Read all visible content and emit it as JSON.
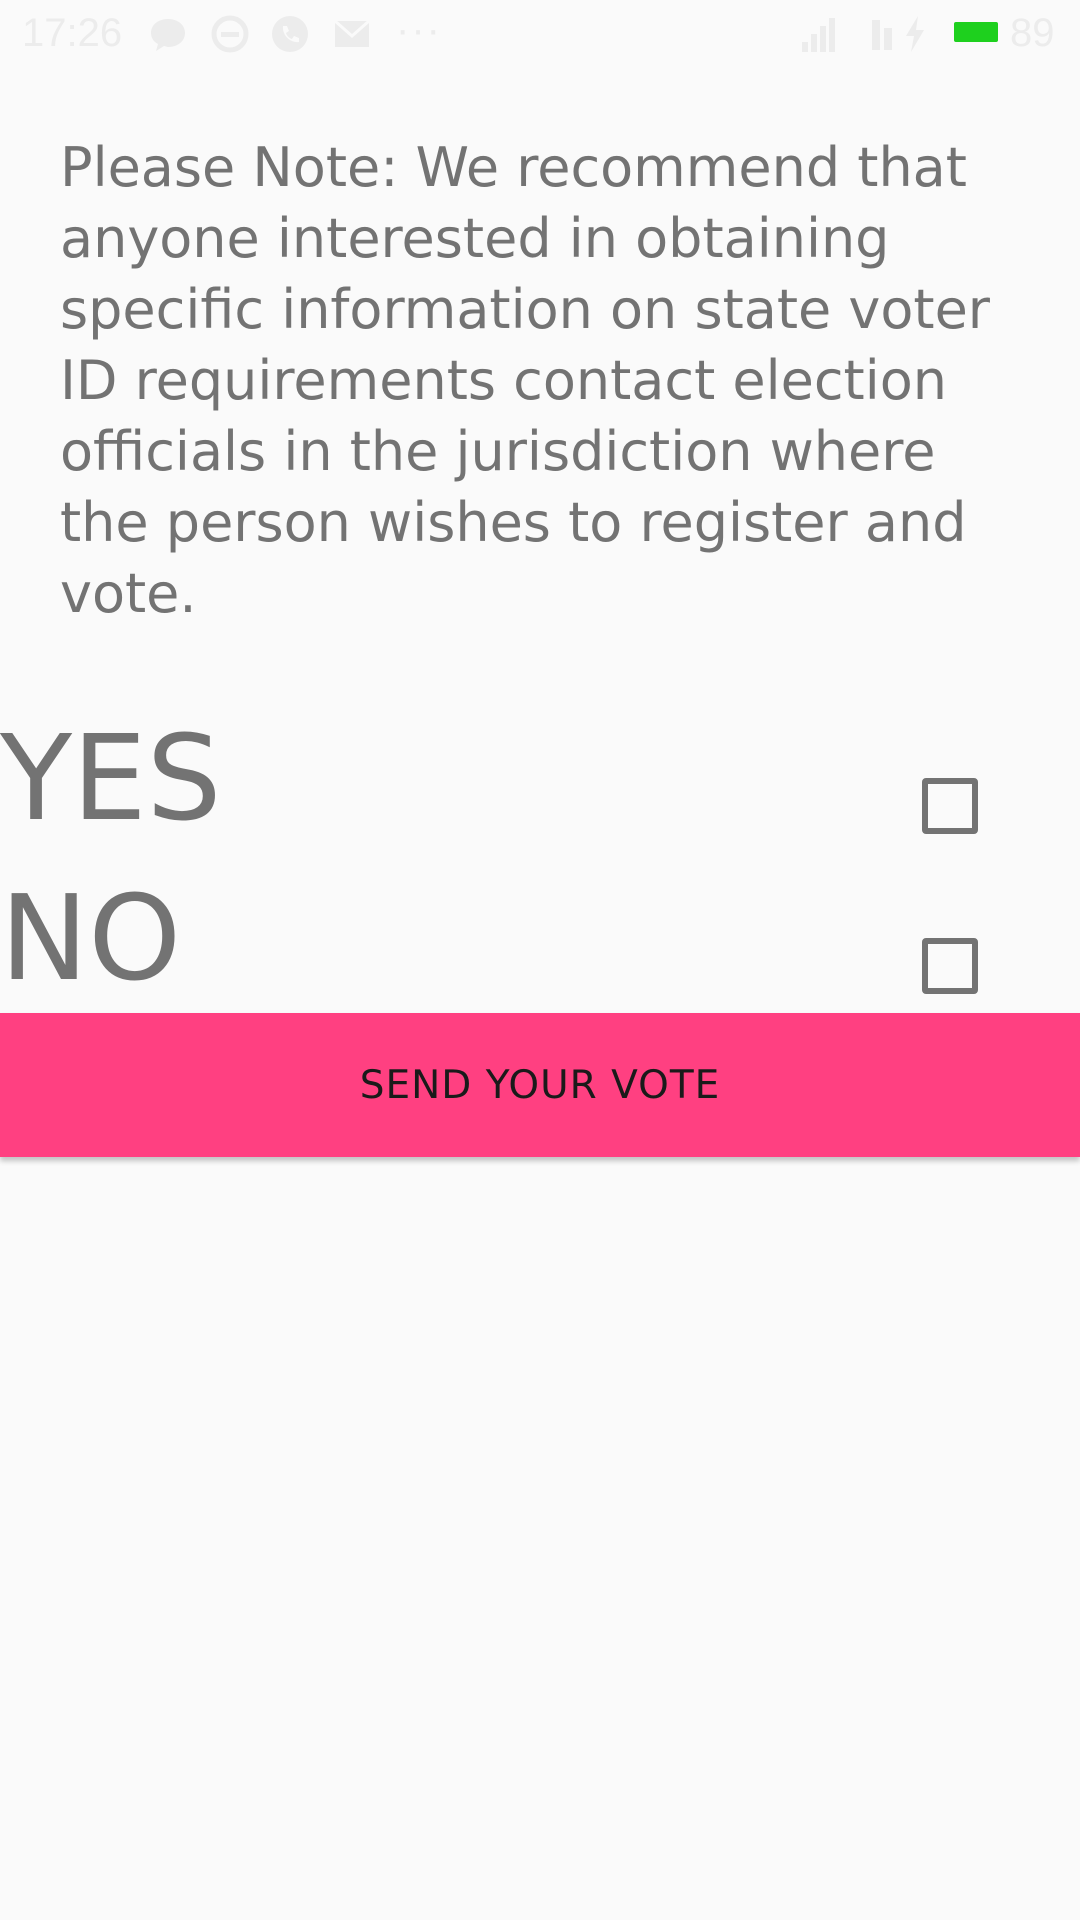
{
  "status_bar": {
    "time": "17:26",
    "battery_level": "89",
    "more_label": "···",
    "battery_color": "#1ed01e",
    "icons": [
      "chat-bubble-icon",
      "message-icon",
      "phone-icon",
      "email-icon",
      "signal-icon",
      "network-4g-icon",
      "charging-icon",
      "battery-icon"
    ]
  },
  "note": {
    "text": "Please Note: We recommend that anyone interested in obtaining specific information on state voter ID requirements contact election officials in the jurisdiction where the person wishes to register and vote."
  },
  "options": {
    "yes_label": "YES",
    "no_label": "NO",
    "yes_checked": false,
    "no_checked": false
  },
  "send_button": {
    "label": "SEND YOUR VOTE",
    "color": "#ff4081"
  },
  "colors": {
    "background": "#fafafa",
    "text": "#737373"
  }
}
